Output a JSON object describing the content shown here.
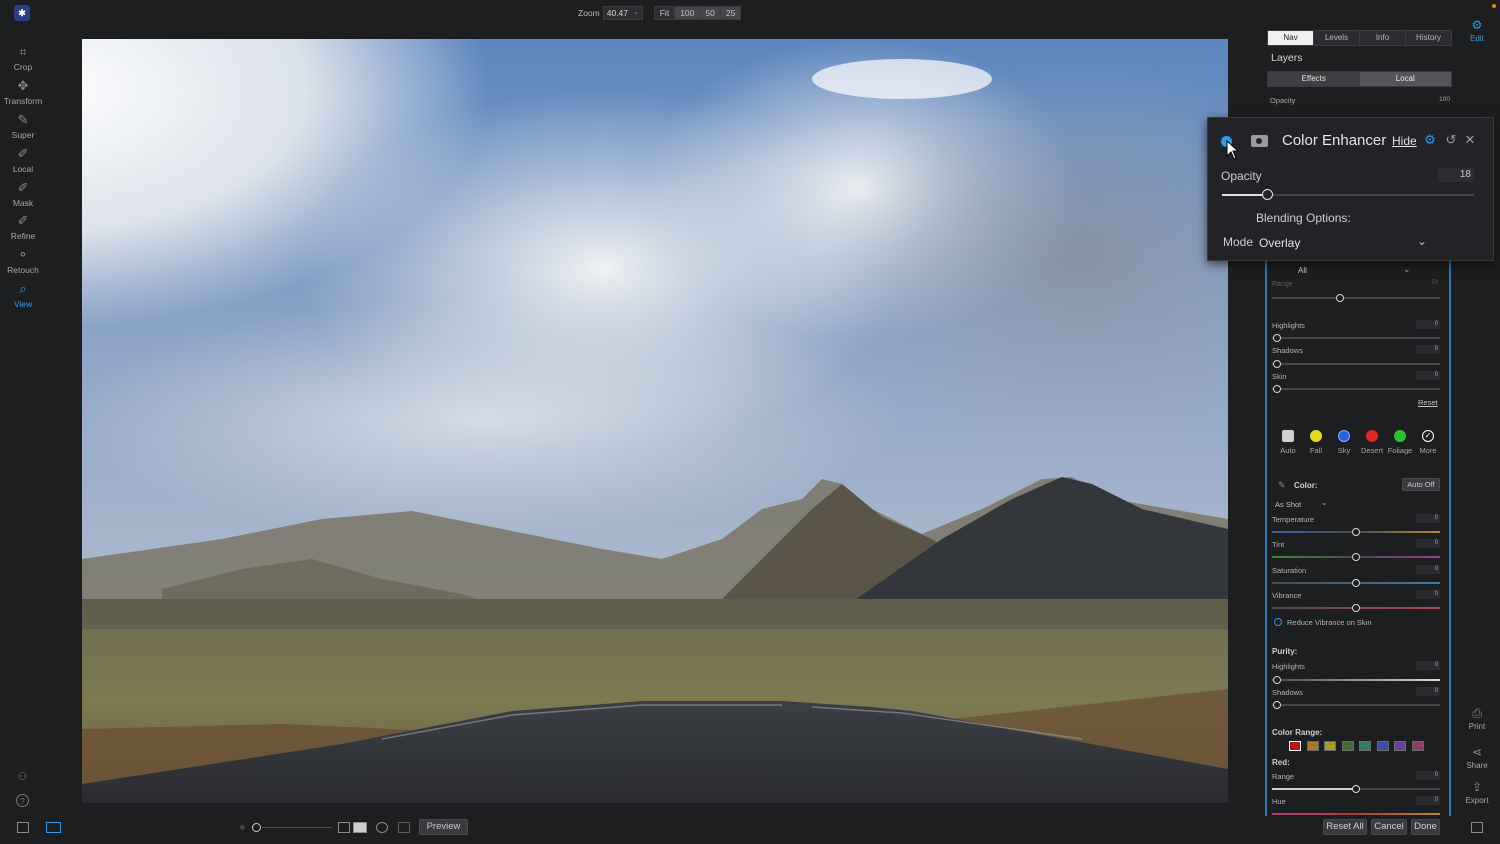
{
  "toolbar": {
    "tools": [
      {
        "label": "Crop",
        "icon": "crop-icon"
      },
      {
        "label": "Transform",
        "icon": "transform-icon"
      },
      {
        "label": "Super",
        "icon": "super-icon"
      },
      {
        "label": "Local",
        "icon": "local-brush-icon"
      },
      {
        "label": "Mask",
        "icon": "mask-brush-icon"
      },
      {
        "label": "Refine",
        "icon": "refine-brush-icon"
      },
      {
        "label": "Retouch",
        "icon": "retouch-icon"
      },
      {
        "label": "View",
        "icon": "view-zoom-icon",
        "active": true
      }
    ]
  },
  "topbar": {
    "zoom_label": "Zoom",
    "zoom_value": "40.47",
    "zoom_presets": [
      "Fit",
      "100",
      "50",
      "25"
    ]
  },
  "panel": {
    "tabs": [
      "Nav",
      "Levels",
      "Info",
      "History"
    ],
    "title": "Layers",
    "layer_tabs": [
      "Effects",
      "Local"
    ],
    "opacity_label": "Opacity",
    "opacity_value": "100",
    "filter_select": "All",
    "range_label": "Range",
    "range_value": "50",
    "sliders_top": [
      {
        "label": "Highlights",
        "value": "0"
      },
      {
        "label": "Shadows",
        "value": "0"
      },
      {
        "label": "Skin",
        "value": "0"
      }
    ],
    "reset_label": "Reset",
    "presets": [
      {
        "label": "Auto",
        "color": "#cfcfcf"
      },
      {
        "label": "Fall",
        "color": "#e8d51e"
      },
      {
        "label": "Sky",
        "color": "#2a5fe0"
      },
      {
        "label": "Desert",
        "color": "#e02626"
      },
      {
        "label": "Foliage",
        "color": "#2fbf2f"
      },
      {
        "label": "More",
        "color": "#ffffff"
      }
    ],
    "color_header": "Color:",
    "auto_off_label": "Auto Off",
    "white_balance": "As Shot",
    "color_sliders": [
      {
        "label": "Temperature",
        "value": "0"
      },
      {
        "label": "Tint",
        "value": "0"
      },
      {
        "label": "Saturation",
        "value": "0"
      },
      {
        "label": "Vibrance",
        "value": "0"
      }
    ],
    "reduce_vibrance_label": "Reduce Vibrance on Skin",
    "purity_header": "Purity:",
    "purity_sliders": [
      {
        "label": "Highlights",
        "value": "0"
      },
      {
        "label": "Shadows",
        "value": "0"
      }
    ],
    "color_range_header": "Color Range:",
    "swatches": [
      "#b3161b",
      "#a8752c",
      "#a89a2c",
      "#4a6a3a",
      "#3d7a6a",
      "#3a4fa6",
      "#6a3f9a",
      "#8a3f6a"
    ],
    "red_header": "Red:",
    "red_sliders": [
      {
        "label": "Range",
        "value": "0"
      },
      {
        "label": "Hue",
        "value": "0"
      }
    ]
  },
  "right_edge": {
    "edit_label": "Edit",
    "print_label": "Print",
    "share_label": "Share",
    "export_label": "Export"
  },
  "enhancer": {
    "title": "Color Enhancer",
    "hide_label": "Hide",
    "opacity_label": "Opacity",
    "opacity_value": "18",
    "opacity_fraction": 0.18,
    "blending_label": "Blending Options:",
    "mode_label": "Mode",
    "mode_value": "Overlay"
  },
  "bottom": {
    "preview_label": "Preview",
    "reset_all_label": "Reset All",
    "cancel_label": "Cancel",
    "done_label": "Done"
  }
}
